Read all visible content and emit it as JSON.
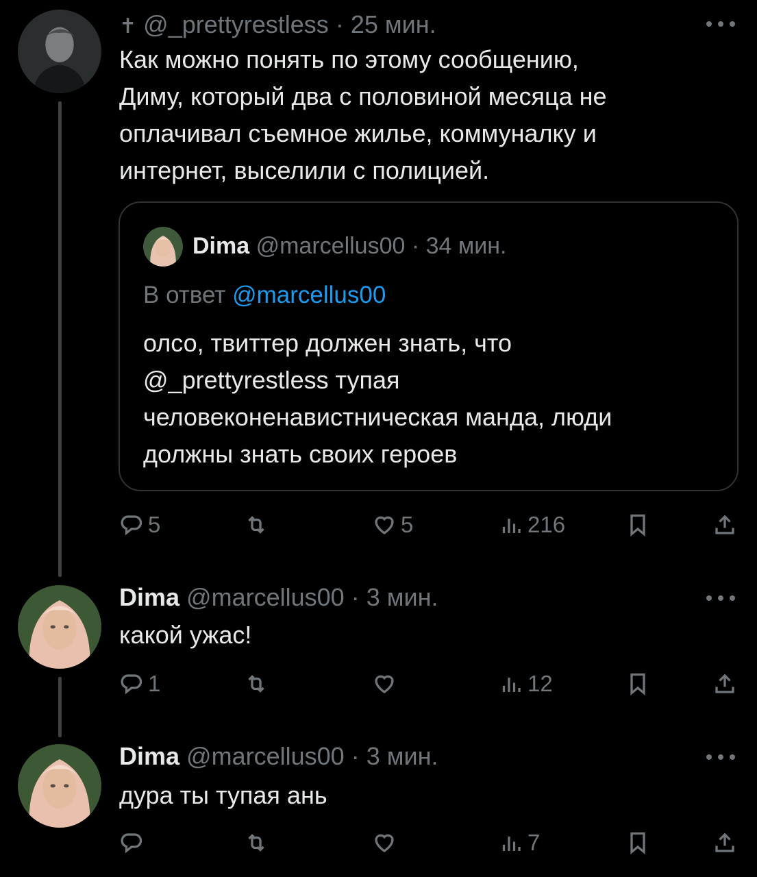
{
  "posts": [
    {
      "author_prefix": "✝",
      "handle": "@_prettyrestless",
      "time": "25 мин.",
      "text_lines": [
        "Как можно понять по этому сообщению,",
        "Диму, который два с половиной месяца не",
        "оплачивал съемное жилье, коммуналку и",
        "интернет, выселили с полицией."
      ],
      "quote": {
        "name": "Dima",
        "handle": "@marcellus00",
        "time": "34 мин.",
        "reply_prefix": "В ответ",
        "reply_mention": "@marcellus00",
        "text_lines": [
          "олсо, твиттер должен знать, что",
          "@_prettyrestless тупая",
          "человеконенавистническая манда, люди",
          "должны знать своих героев"
        ]
      },
      "actions": {
        "replies": "5",
        "retweets": "",
        "likes": "5",
        "views": "216"
      }
    },
    {
      "name": "Dima",
      "handle": "@marcellus00",
      "time": "3 мин.",
      "text": "какой ужас!",
      "actions": {
        "replies": "1",
        "retweets": "",
        "likes": "",
        "views": "12"
      }
    },
    {
      "name": "Dima",
      "handle": "@marcellus00",
      "time": "3 мин.",
      "text": "дура ты тупая ань",
      "actions": {
        "replies": "",
        "retweets": "",
        "likes": "",
        "views": "7"
      }
    }
  ],
  "separator": "·",
  "colors": {
    "background": "#000000",
    "text": "#e7e9ea",
    "muted": "#71767b",
    "link": "#1d9bf0",
    "border": "#2f3336"
  },
  "icons": [
    "reply-icon",
    "retweet-icon",
    "like-icon",
    "views-icon",
    "bookmark-icon",
    "share-icon",
    "more-icon"
  ]
}
